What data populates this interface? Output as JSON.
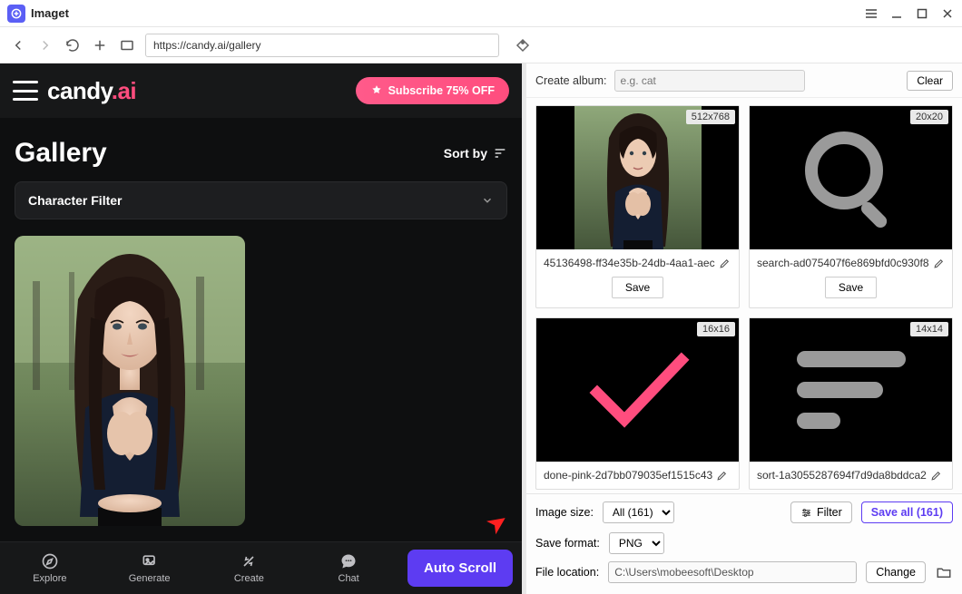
{
  "app": {
    "title": "Imaget"
  },
  "toolbar": {
    "url": "https://candy.ai/gallery"
  },
  "left": {
    "brand_prefix": "candy",
    "brand_suffix": ".ai",
    "subscribe": "Subscribe 75% OFF",
    "gallery_title": "Gallery",
    "sort_by": "Sort by",
    "filter": "Character Filter",
    "nav": {
      "explore": "Explore",
      "generate": "Generate",
      "create": "Create",
      "chat": "Chat"
    },
    "auto_scroll": "Auto Scroll"
  },
  "right": {
    "create_album_label": "Create album:",
    "album_placeholder": "e.g. cat",
    "clear": "Clear",
    "thumbs": [
      {
        "dim": "512x768",
        "name": "45136498-ff34e35b-24db-4aa1-aec",
        "save": "Save"
      },
      {
        "dim": "20x20",
        "name": "search-ad075407f6e869bfd0c930f8",
        "save": "Save"
      },
      {
        "dim": "16x16",
        "name": "done-pink-2d7bb079035ef1515c43"
      },
      {
        "dim": "14x14",
        "name": "sort-1a3055287694f7d9da8bddca2"
      }
    ],
    "image_size_label": "Image size:",
    "image_size_value": "All (161)",
    "filter_btn": "Filter",
    "save_all": "Save all (161)",
    "save_format_label": "Save format:",
    "save_format_value": "PNG",
    "file_location_label": "File location:",
    "file_location_value": "C:\\Users\\mobeesoft\\Desktop",
    "change": "Change"
  }
}
